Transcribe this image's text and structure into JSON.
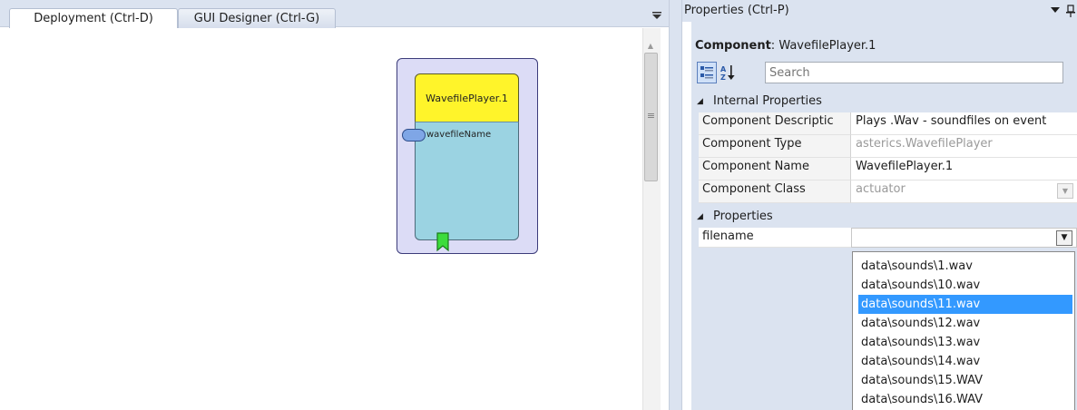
{
  "tabs": {
    "deployment": "Deployment (Ctrl-D)",
    "gui_designer": "GUI Designer (Ctrl-G)"
  },
  "canvas": {
    "component": {
      "title": "WavefilePlayer.1",
      "input_port": "wavefileName"
    }
  },
  "properties": {
    "title": "Properties (Ctrl-P)",
    "component_label": "Component",
    "component_value": "WavefilePlayer.1",
    "search_placeholder": "Search",
    "internal_section": "Internal Properties",
    "rows": [
      {
        "name": "Component Descriptic",
        "value": "Plays .Wav - soundfiles on event"
      },
      {
        "name": "Component Type",
        "value": "asterics.WavefilePlayer"
      },
      {
        "name": "Component Name",
        "value": "WavefilePlayer.1"
      },
      {
        "name": "Component Class",
        "value": "actuator"
      }
    ],
    "properties_section": "Properties",
    "filename_label": "filename",
    "filename_value": "",
    "dropdown_options": [
      "data\\sounds\\1.wav",
      "data\\sounds\\10.wav",
      "data\\sounds\\11.wav",
      "data\\sounds\\12.wav",
      "data\\sounds\\13.wav",
      "data\\sounds\\14.wav",
      "data\\sounds\\15.WAV",
      "data\\sounds\\16.WAV"
    ],
    "dropdown_selected": "data\\sounds\\11.wav"
  },
  "colors": {
    "chrome": "#dbe3f0",
    "component_title": "#fff42a",
    "component_body": "#9bd3e2",
    "component_frame": "#dcdcf6",
    "event_port": "#3cdc3c",
    "selection": "#3399ff"
  },
  "icons": {
    "tab_menu": "dropdown-triangle-icon",
    "panel_menu": "dropdown-triangle-icon",
    "panel_pin": "pin-icon",
    "categorized": "categorized-icon",
    "alphabetical": "sort-az-icon",
    "collapse": "collapse-triangle-icon"
  }
}
